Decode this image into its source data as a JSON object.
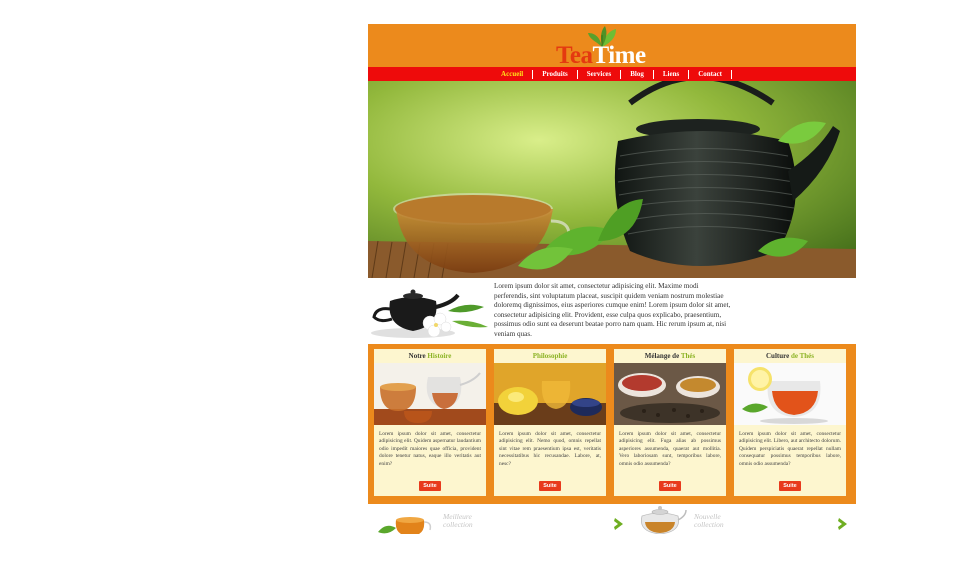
{
  "logo": {
    "part1": "Tea",
    "part2": "Time"
  },
  "nav": [
    {
      "label": "Accueil",
      "active": true
    },
    {
      "label": "Produits"
    },
    {
      "label": "Services"
    },
    {
      "label": "Blog"
    },
    {
      "label": "Liens"
    },
    {
      "label": "Contact"
    }
  ],
  "intro": {
    "text": "Lorem ipsum dolor sit amet, consectetur adipisicing elit. Maxime modi perferendis, sint voluptatum placeat, suscipit quidem veniam nostrum molestiae doloremq dignissimos, eius asperiores cumque enim! Lorem ipsum dolor sit amet, consectetur adipisicing elit. Provident, esse culpa quos explicabo, praesentium, possimus odio sunt ea deserunt beatae porro nam quam. Hic rerum ipsum at, nisi veniam quas."
  },
  "cards": [
    {
      "title_a": "Notre ",
      "title_b": "Histoire",
      "text": "Lorem ipsum dolor sit amet, consectetur adipisicing elit. Quidem aspernatur laudantium odio impedit maiores quae officia, provident dolore tenetur natus, eaque illo veritatis aut enim?",
      "button": "Suite"
    },
    {
      "title_a": "",
      "title_b": "Philosophie",
      "text": "Lorem ipsum dolor sit amet, consectetur adipisicing elit. Nemo quod, omnis repellat sint vitae rem praesentium ipsa est, veritatis necessitatibus hic recusandae. Labore, at, nesc?",
      "button": "Suite"
    },
    {
      "title_a": "Mélange de ",
      "title_b": "Thés",
      "text": "Lorem ipsum dolor sit amet, consectetur adipisicing elit. Fuga alias ab possimus asperiores assumenda, quaerat aut mollitia. Vero laboriosam sunt, temporibus labore, omnis odio assumenda?",
      "button": "Suite"
    },
    {
      "title_a": "Culture ",
      "title_b": "de Thés",
      "text": "Lorem ipsum dolor sit amet, consectetur adipisicing elit. Libero, aut architecto dolorum. Quidem perspiciatis quaerat repellat nullam consequatur possimus temporibus labore, omnis odio assumenda?",
      "button": "Suite"
    }
  ],
  "bottom": {
    "left_line1": "Meilleure",
    "left_line2": "collection",
    "right_line1": "Nouvelle",
    "right_line2": "collection"
  },
  "colors": {
    "orange": "#ec8a1c",
    "red_nav": "#ee0b0b",
    "accent_green": "#8cb324",
    "card_bg": "#fdf6cf",
    "button": "#e83a1c"
  }
}
